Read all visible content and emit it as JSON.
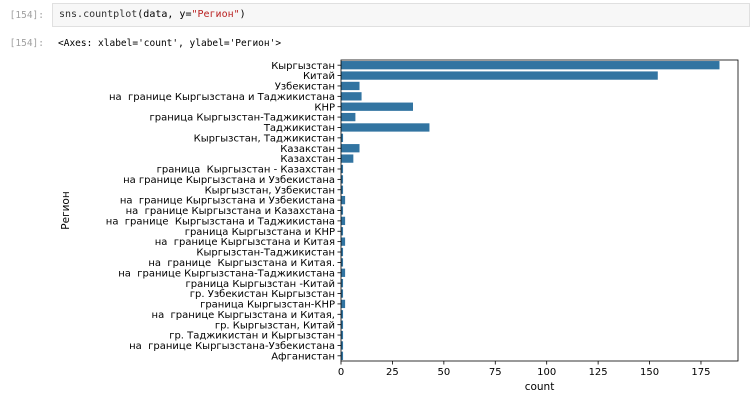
{
  "cell": {
    "in_prompt": "[154]:",
    "out_prompt": "[154]:",
    "code_fn": "sns.countplot",
    "code_open": "(data, y=",
    "code_str": "\"Регион\"",
    "code_close": ")",
    "output": "<Axes: xlabel='count', ylabel='Регион'>"
  },
  "chart_data": {
    "type": "bar",
    "orientation": "horizontal",
    "bar_color": "#3274a1",
    "xlabel": "count",
    "ylabel": "Регион",
    "xlim": [
      0,
      193
    ],
    "xticks": [
      0,
      25,
      50,
      75,
      100,
      125,
      150,
      175
    ],
    "grid": false,
    "categories": [
      "Кыргызстан",
      "Китай",
      "Узбекистан",
      "на  границе Кыргызстана и Таджикистана",
      "КНР",
      "граница Кыргызстан-Таджикистан",
      "Таджикистан",
      "Кыргызстан, Таджикистан",
      "Казакстан",
      "Казахстан",
      "граница  Кыргызстан - Казахстан",
      "на границе Кыргызстана и Узбекистана",
      "Кыргызстан, Узбекистан",
      "на  границе Кыргызстана и Узбекистана",
      "на  границе Кыргызстана и Казахстана",
      "на  границе  Кыргызстана и Таджикистана",
      "граница Кыргызстана и КНР",
      "на  границе Кыргызстана и Китая",
      "Кыргызстан-Таджикистан",
      "на  границе  Кыргызстана и Китая.",
      "на  границе Кыргызстана-Таджикистана",
      "граница Кыргызстан -Китай",
      "гр. Узбекистан Кыргызстан",
      "граница Кыргызстан-КНР",
      "на  границе Кыргызстана и Китая,",
      "гр. Кыргызстан, Китай",
      "гр. Таджикистан и Кыргызстан",
      "на  границе Кыргызстана-Узбекистана",
      "Афганистан"
    ],
    "values": [
      184,
      154,
      9,
      10,
      35,
      7,
      43,
      1,
      9,
      6,
      1,
      1,
      1,
      2,
      1,
      2,
      1,
      2,
      1,
      1,
      2,
      1,
      1,
      2,
      1,
      1,
      1,
      1,
      1
    ]
  }
}
